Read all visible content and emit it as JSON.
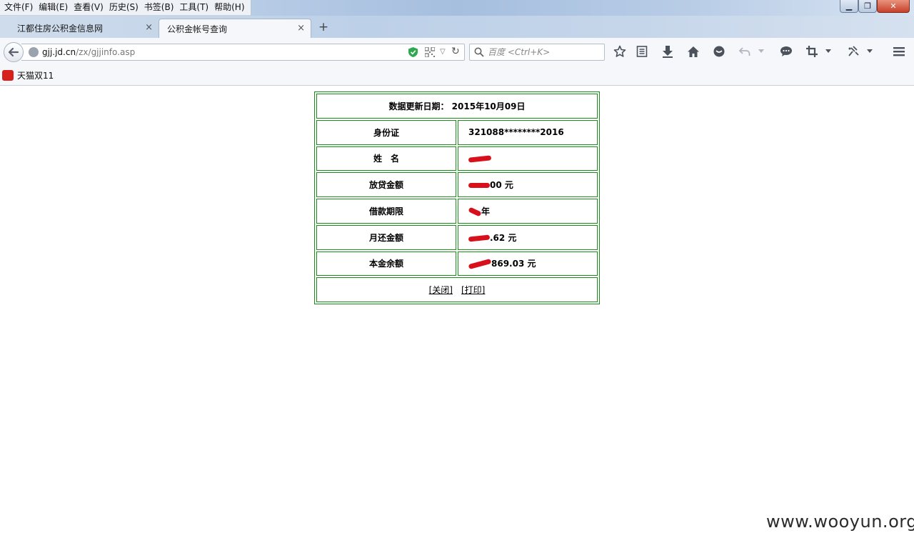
{
  "menu": {
    "items": [
      "文件(F)",
      "编辑(E)",
      "查看(V)",
      "历史(S)",
      "书签(B)",
      "工具(T)",
      "帮助(H)"
    ]
  },
  "window": {
    "minimize_glyph": "▁",
    "maximize_glyph": "❐",
    "close_glyph": "✕"
  },
  "tabs": [
    {
      "label": "江都住房公积金信息网",
      "close": "×"
    },
    {
      "label": "公积金帐号查询",
      "close": "×"
    }
  ],
  "new_tab_glyph": "+",
  "address": {
    "domain": "gjj.jd.cn",
    "path": "/zx/gjjinfo.asp"
  },
  "search": {
    "placeholder": "百度 <Ctrl+K>"
  },
  "toolbar_icons": [
    "star-icon",
    "reading-list-icon",
    "download-icon",
    "home-icon",
    "chat-icon",
    "undo-icon",
    "comment-icon",
    "crop-icon",
    "extension-icon",
    "menu-icon"
  ],
  "bookmarks": [
    {
      "label": "天猫双11",
      "icon": "tmall-icon"
    }
  ],
  "info": {
    "header": "数据更新日期： 2015年10月09日",
    "rows": [
      {
        "label": "身份证",
        "value": "321088********2016"
      },
      {
        "label": "姓　名",
        "value": ""
      },
      {
        "label": "放贷金额",
        "value": "00 元"
      },
      {
        "label": "借款期限",
        "value": "年"
      },
      {
        "label": "月还金额",
        "value": ".62 元"
      },
      {
        "label": "本金余额",
        "value": "869.03 元"
      }
    ],
    "close_link": "[关闭]",
    "print_link": "[打印]"
  },
  "watermark": "www.wooyun.org",
  "colors": {
    "table_border": "#1a8c1a",
    "redaction": "#d8101c"
  }
}
